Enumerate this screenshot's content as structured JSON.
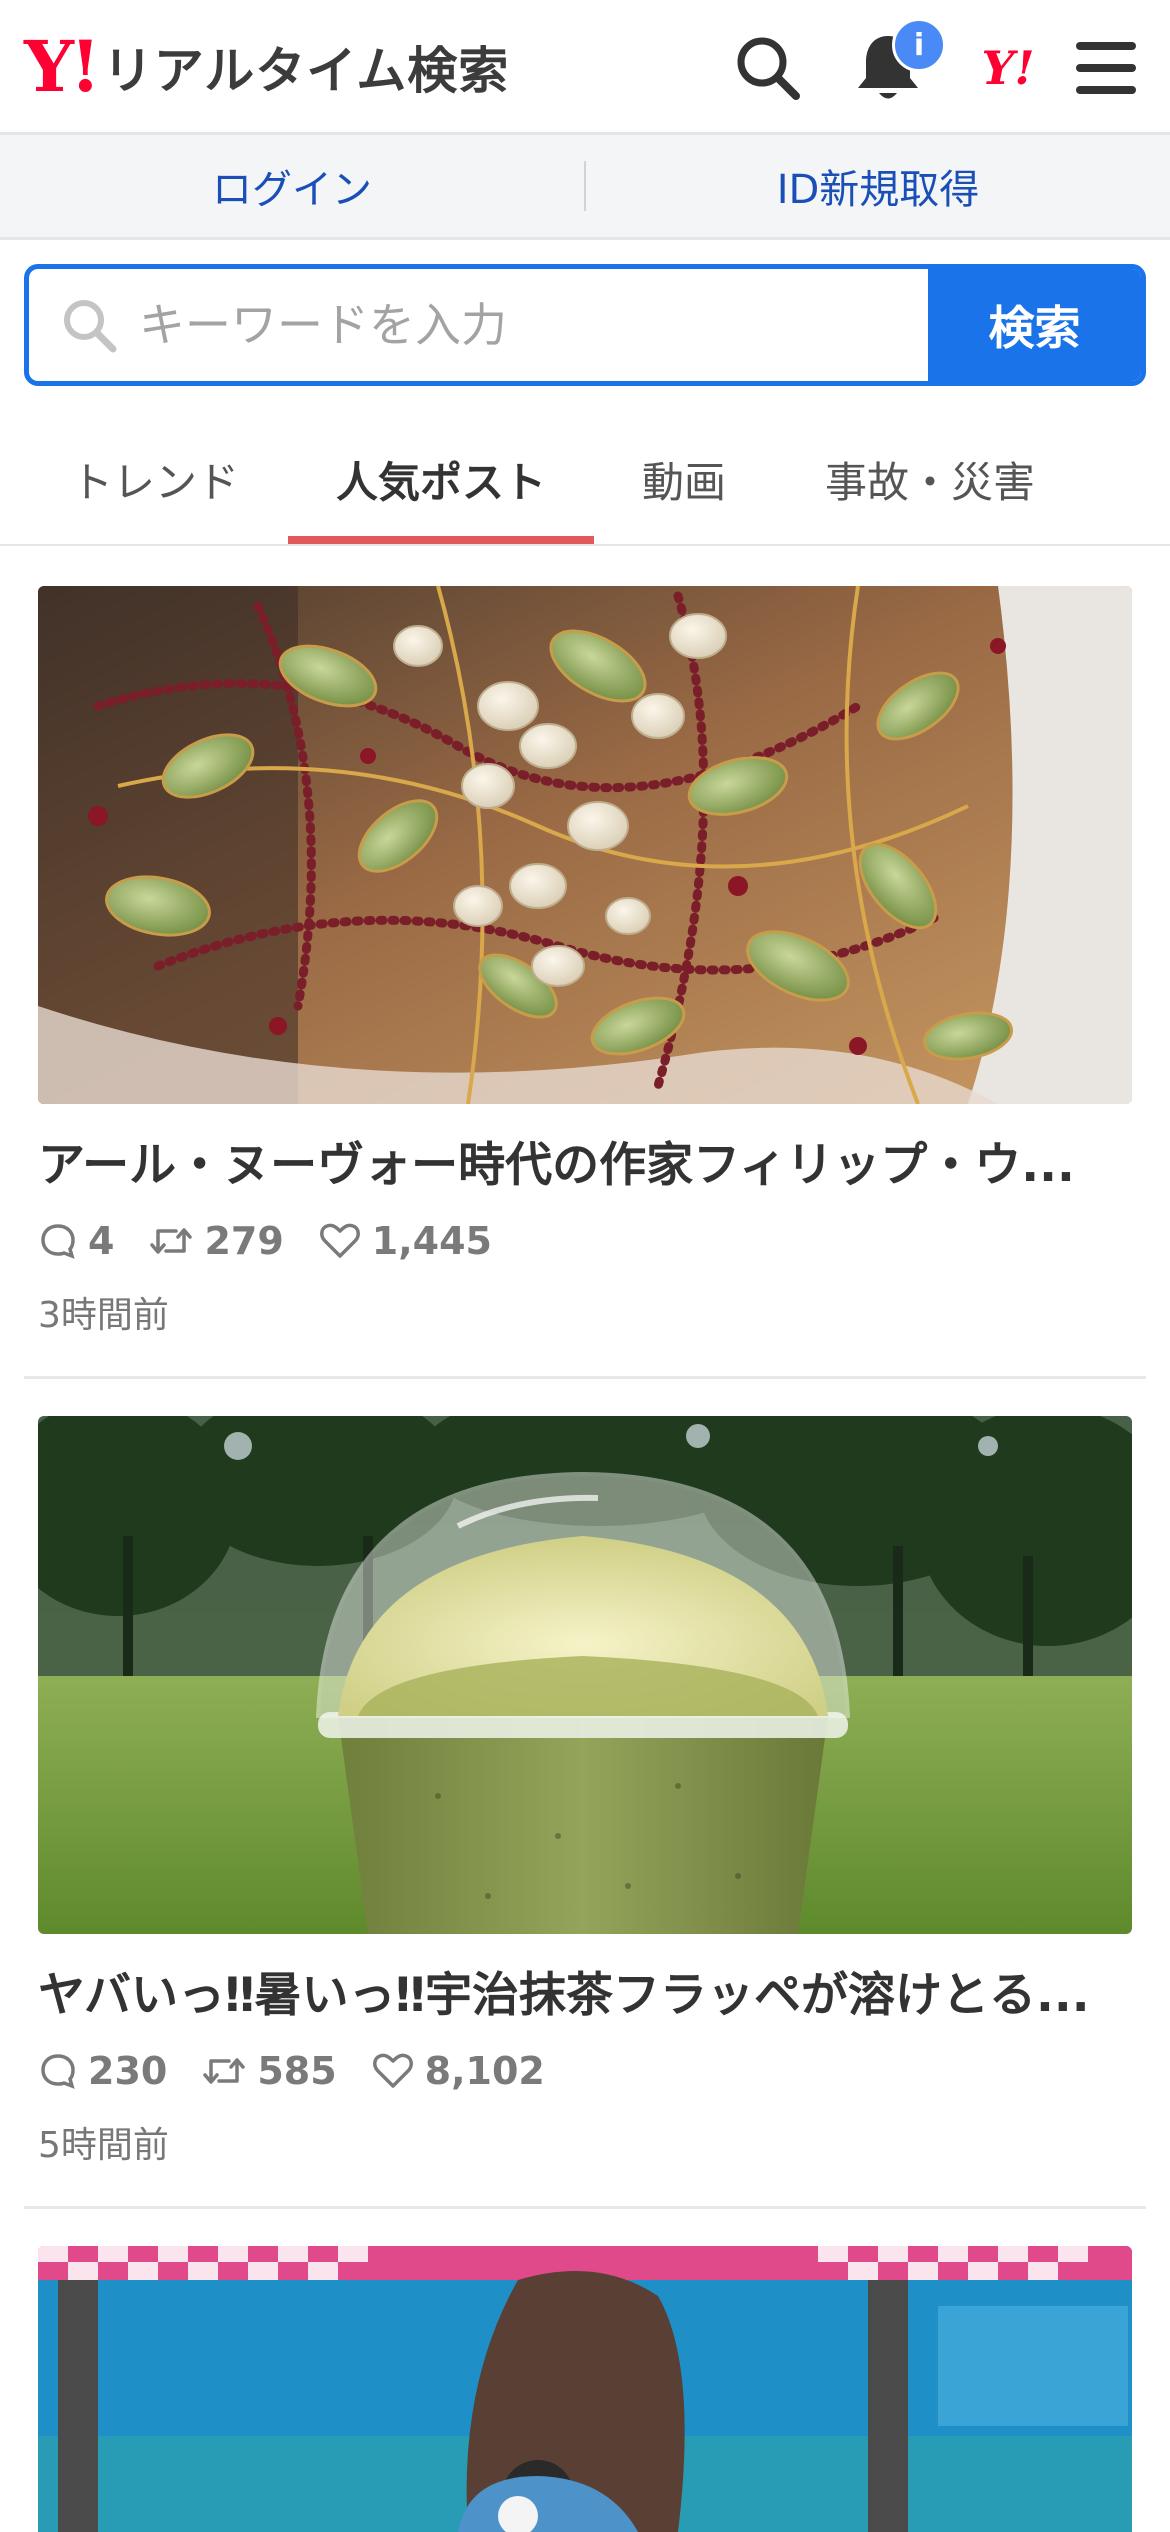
{
  "header": {
    "logo_mark": "Y!",
    "logo_text": "リアルタイム検索",
    "notification_badge": "i",
    "yahoo_mark": "Y!"
  },
  "account": {
    "login_label": "ログイン",
    "register_label": "ID新規取得"
  },
  "search": {
    "placeholder": "キーワードを入力",
    "button_label": "検索"
  },
  "tabs": [
    {
      "label": "トレンド",
      "active": false
    },
    {
      "label": "人気ポスト",
      "active": true
    },
    {
      "label": "動画",
      "active": false
    },
    {
      "label": "事故・災害",
      "active": false
    }
  ],
  "posts": [
    {
      "title": "アール・ヌーヴォー時代の作家フィリップ・ウ...",
      "replies": "4",
      "reposts": "279",
      "likes": "1,445",
      "time": "3時間前",
      "image": "ornate-jewelry-collar"
    },
    {
      "title": "ヤバいっ‼暑いっ‼宇治抹茶フラッペが溶けとる...",
      "replies": "230",
      "reposts": "585",
      "likes": "8,102",
      "time": "5時間前",
      "image": "matcha-frappe-in-park"
    },
    {
      "title": "",
      "image": "sea-lion-aquarium"
    }
  ],
  "colors": {
    "brand_red": "#ff0033",
    "accent_blue": "#1a73e8",
    "tab_underline": "#e05a5a",
    "link_blue": "#1b4fb8"
  }
}
